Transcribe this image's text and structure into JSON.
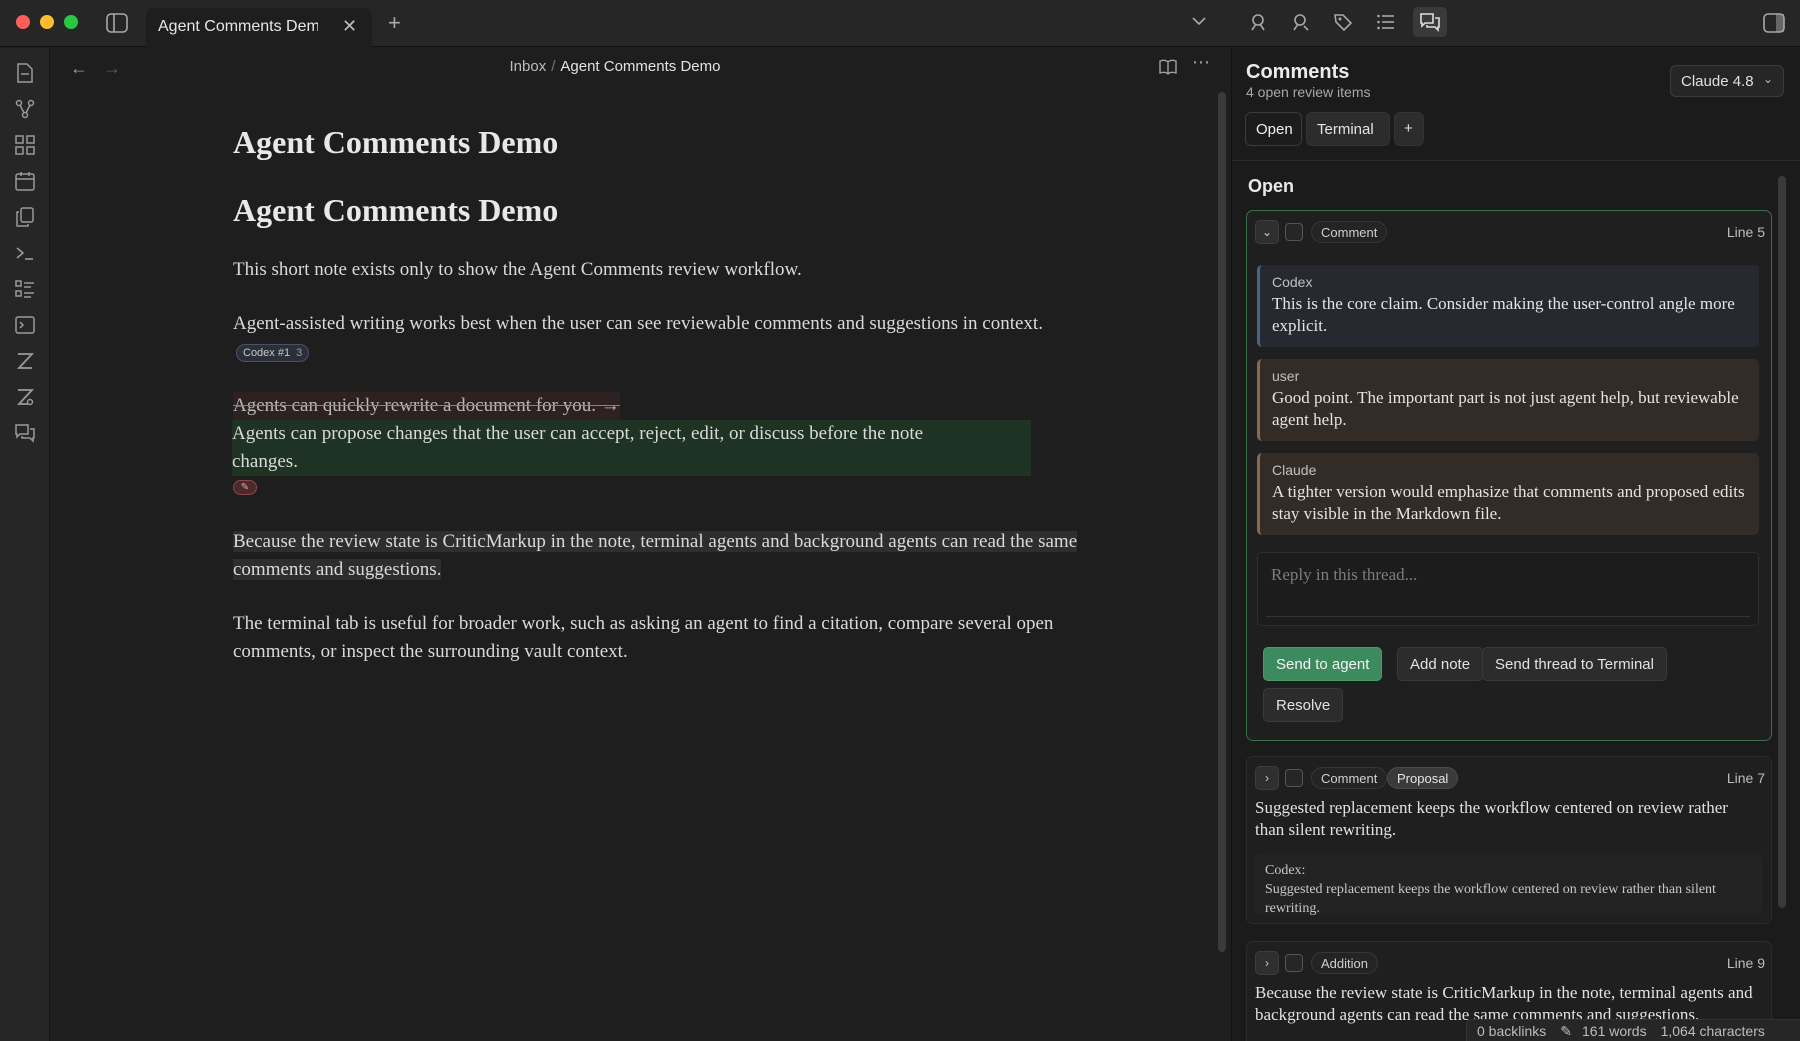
{
  "tab": {
    "title": "Agent Comments Demo"
  },
  "breadcrumb": {
    "parent": "Inbox",
    "separator": "/",
    "current": "Agent Comments Demo"
  },
  "document": {
    "title1": "Agent Comments Demo",
    "title2": "Agent Comments Demo",
    "p1": "This short note exists only to show the Agent Comments review workflow.",
    "p2": "Agent-assisted writing works best when the user can see reviewable comments and suggestions in context.",
    "p2_chip": "Codex #1",
    "p2_chip_count": "3",
    "deleted": "Agents can quickly rewrite a document for you.",
    "arrow": " → ",
    "inserted": "Agents can propose changes that the user can accept, reject, edit, or discuss before the note changes.",
    "edit_chip": "✎",
    "p3": "Because the review state is CriticMarkup in the note, terminal agents and background agents can read the same comments and suggestions.",
    "p4": "The terminal tab is useful for broader work, such as asking an agent to find a citation, compare several open comments, or inspect the surrounding vault context."
  },
  "panel": {
    "title": "Comments",
    "subtitle": "4 open review items",
    "model": "Claude 4.8",
    "tabs": [
      "Open",
      "Terminal"
    ],
    "add_tab": "+",
    "section": "Open",
    "card1": {
      "type": "Comment",
      "line": "Line 5",
      "messages": [
        {
          "author": "Codex",
          "text": "This is the core claim. Consider making the user-control angle more explicit."
        },
        {
          "author": "user",
          "text": "Good point. The important part is not just agent help, but reviewable agent help."
        },
        {
          "author": "Claude",
          "text": "A tighter version would emphasize that comments and proposed edits stay visible in the Markdown file."
        }
      ],
      "reply_placeholder": "Reply in this thread...",
      "buttons": {
        "send": "Send to agent",
        "note": "Add note",
        "terminal": "Send thread to Terminal",
        "resolve": "Resolve"
      }
    },
    "card2": {
      "type": "Comment",
      "badge": "Proposal",
      "line": "Line 7",
      "text": "Suggested replacement keeps the workflow centered on review rather than silent rewriting.",
      "quote_author": "Codex:",
      "quote_text": "Suggested replacement keeps the workflow centered on review rather than silent rewriting."
    },
    "card3": {
      "type": "Addition",
      "line": "Line 9",
      "text": "Because the review state is CriticMarkup in the note, terminal agents and background agents can read the same comments and suggestions."
    }
  },
  "status": {
    "backlinks": "0 backlinks",
    "words": "161 words",
    "chars": "1,064 characters"
  },
  "colors": {
    "accent": "#3c8a5e",
    "insert_bg": "#1f3324",
    "codex_bar": "#4b6584",
    "user_bar": "#8a6a4a"
  }
}
